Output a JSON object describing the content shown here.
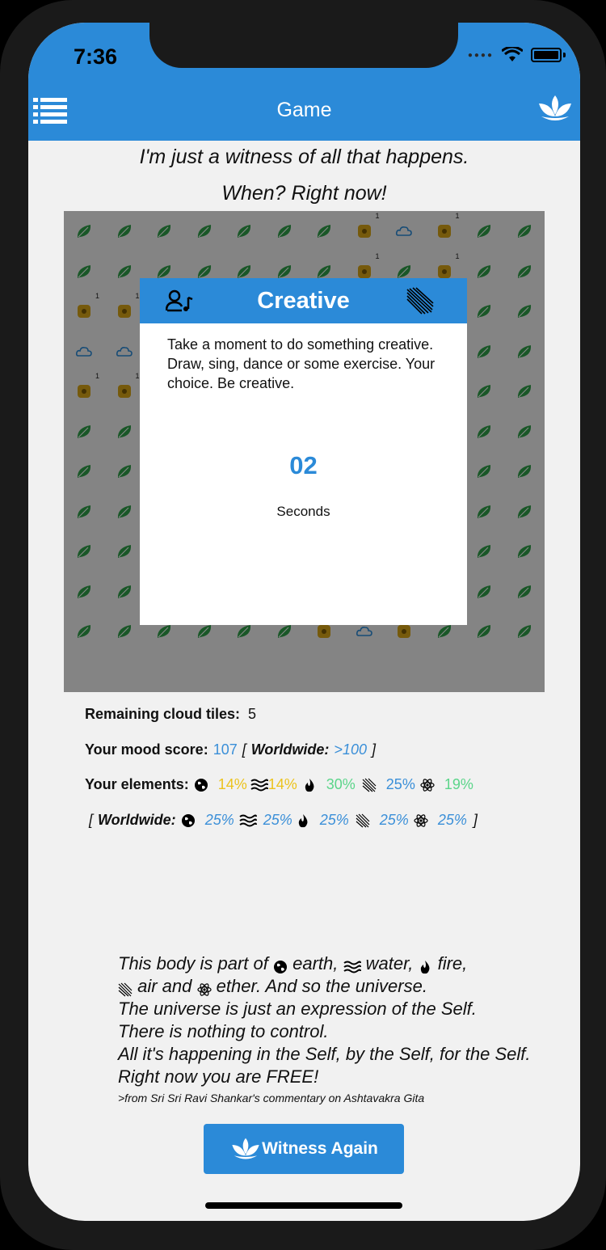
{
  "status_bar": {
    "time": "7:36"
  },
  "nav": {
    "title": "Game",
    "menu_icon": "list-icon",
    "brand_icon": "lotus-icon"
  },
  "quote": {
    "line1": "I'm just a witness of all that happens.",
    "line2": "When? Right now!"
  },
  "board": {
    "tiles": [
      "LLLLLLLFCFLL",
      "LLLLLLLFLFLL",
      "FFLLLLLLLLLL",
      "CCLLLLLLLLLL",
      "FFLLLLLLLLLL",
      "LLLLLLLLLLLL",
      "LLLLLLLLLLLL",
      "LLLLLLLLLLLL",
      "LLLLLLLLLLLL",
      "LLLLLLFPFLLL",
      "LLLLLLFCFLLL"
    ],
    "tile_badge": "1",
    "flower_color": "#d7a516",
    "leaf_color": "#2f9e48",
    "cloud_color": "#2b8ad8",
    "player_color": "#c0282a"
  },
  "dialog": {
    "title": "Creative",
    "left_icon": "user-music-icon",
    "right_icon": "air-icon",
    "text": "Take a moment to do something creative. Draw, sing, dance or some exercise. Your choice. Be creative.",
    "counter": "02",
    "counter_label": "Seconds"
  },
  "stats": {
    "remaining_label": "Remaining cloud tiles:",
    "remaining_value": "5",
    "mood_label": "Your mood score:",
    "mood_value": "107",
    "bracket_open": "[",
    "bracket_close": "]",
    "worldwide_label": "Worldwide:",
    "mood_worldwide": ">100",
    "elements_label": "Your elements:",
    "elements": {
      "earth": "14%",
      "water": "14%",
      "fire": "30%",
      "air": "25%",
      "ether": "19%"
    },
    "worldwide_elements": {
      "earth": "25%",
      "water": "25%",
      "fire": "25%",
      "air": "25%",
      "ether": "25%"
    }
  },
  "poem": {
    "l1_a": "This body is part of",
    "l1_b": "earth,",
    "l1_c": "water,",
    "l1_d": "fire,",
    "l2_a": "air and",
    "l2_b": "ether. And so the universe.",
    "l3": "The universe is just an expression of the Self.",
    "l4": "There is nothing to control.",
    "l5": "All it's happening in the Self, by the Self, for the Self.",
    "l6": "Right now you are FREE!",
    "source": ">from Sri Sri Ravi Shankar's commentary on Ashtavakra Gita"
  },
  "button": {
    "label": "Witness Again",
    "icon": "lotus-icon"
  },
  "colors": {
    "accent": "#2b8ad8",
    "yellow": "#ecc31c",
    "green": "#5bd58a"
  }
}
